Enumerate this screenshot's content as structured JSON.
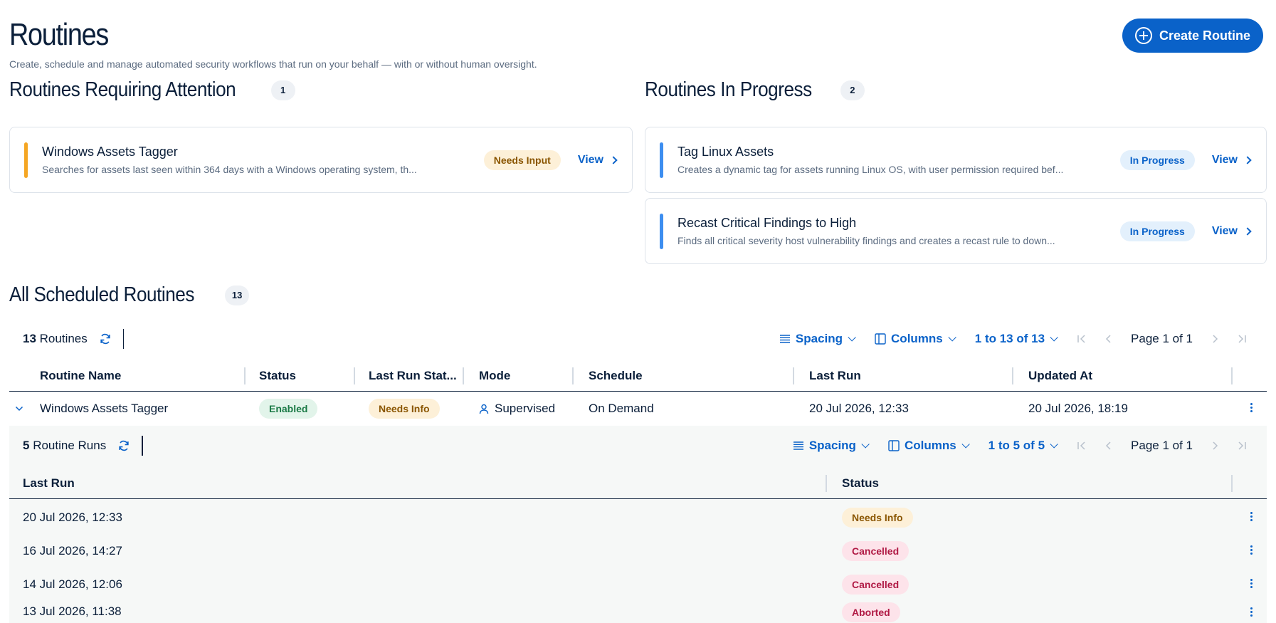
{
  "header": {
    "title": "Routines",
    "subtitle": "Create, schedule and manage automated security workflows that run on your behalf — with or without human oversight.",
    "create_button": "Create Routine"
  },
  "attention": {
    "title": "Routines Requiring Attention",
    "count": "1",
    "cards": [
      {
        "title": "Windows Assets Tagger",
        "description": "Searches for assets last seen within 364 days with a Windows operating system, th...",
        "badge": "Needs Input",
        "link": "View"
      }
    ]
  },
  "in_progress": {
    "title": "Routines In Progress",
    "count": "2",
    "cards": [
      {
        "title": "Tag Linux Assets",
        "description": "Creates a dynamic tag for assets running Linux OS, with user permission required bef...",
        "badge": "In Progress",
        "link": "View"
      },
      {
        "title": "Recast Critical Findings to High",
        "description": "Finds all critical severity host vulnerability findings and creates a recast rule to down...",
        "badge": "In Progress",
        "link": "View"
      }
    ]
  },
  "scheduled": {
    "title": "All Scheduled Routines",
    "count": "13",
    "toolbar": {
      "count_value": "13",
      "count_label": "Routines",
      "spacing": "Spacing",
      "columns": "Columns",
      "range": "1 to 13 of 13",
      "page": "Page 1 of 1"
    },
    "columns": [
      "Routine Name",
      "Status",
      "Last Run Stat...",
      "Mode",
      "Schedule",
      "Last Run",
      "Updated At"
    ],
    "rows": [
      {
        "name": "Windows Assets Tagger",
        "status": "Enabled",
        "last_run_status": "Needs Info",
        "mode": "Supervised",
        "schedule": "On Demand",
        "last_run": "20 Jul 2026, 12:33",
        "updated_at": "20 Jul 2026, 18:19"
      }
    ]
  },
  "runs": {
    "toolbar": {
      "count_value": "5",
      "count_label": "Routine Runs",
      "spacing": "Spacing",
      "columns": "Columns",
      "range": "1 to 5 of 5",
      "page": "Page 1 of 1"
    },
    "columns": [
      "Last Run",
      "Status"
    ],
    "rows": [
      {
        "last_run": "20 Jul 2026, 12:33",
        "status": "Needs Info"
      },
      {
        "last_run": "16 Jul 2026, 14:27",
        "status": "Cancelled"
      },
      {
        "last_run": "14 Jul 2026, 12:06",
        "status": "Cancelled"
      },
      {
        "last_run": "13 Jul 2026, 11:38",
        "status": "Aborted"
      }
    ]
  },
  "colors": {
    "brand_blue": "#0a62c9",
    "accent_warning": "#f5a623",
    "accent_progress": "#3d8ef0",
    "text_primary": "#0b1f3a",
    "text_muted": "#5b6b80"
  }
}
